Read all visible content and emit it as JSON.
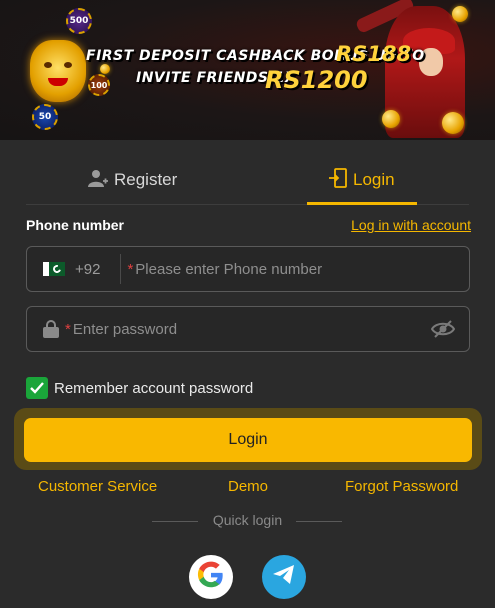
{
  "banner": {
    "line1_text": "FIRST DEPOSIT CASHBACK BONUS UP TO",
    "line1_amount": "RS188",
    "line2_text": "INVITE FRIENDS-1X",
    "line2_amount": "RS1200",
    "chip_labels": [
      "500",
      "100",
      "50"
    ]
  },
  "tabs": {
    "register_label": "Register",
    "login_label": "Login",
    "active": "login"
  },
  "form": {
    "phone_label": "Phone number",
    "login_with_account": "Log in with account",
    "country_code": "+92",
    "required_mark": "*",
    "phone_placeholder": "Please enter Phone number",
    "password_placeholder": "Enter password",
    "remember_label": "Remember account password",
    "remember_checked": true,
    "login_button": "Login"
  },
  "links": {
    "customer_service": "Customer Service",
    "demo": "Demo",
    "forgot_password": "Forgot Password"
  },
  "quick_login": {
    "label": "Quick login",
    "providers": [
      "google-icon",
      "telegram-icon"
    ]
  },
  "colors": {
    "accent": "#f5b700",
    "background": "#2b2b2b",
    "checkbox": "#1aa53a",
    "telegram": "#2aa6e0"
  }
}
